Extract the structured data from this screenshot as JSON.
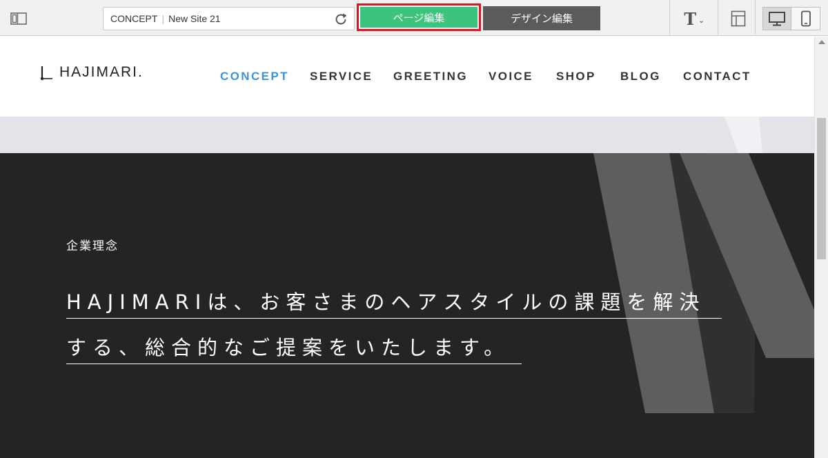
{
  "toolbar": {
    "url_page": "CONCEPT",
    "url_site": "New Site 21",
    "mode_page_label": "ページ編集",
    "mode_design_label": "デザイン編集",
    "font_button": "T",
    "active_device": "desktop",
    "highlight_color": "#e0141e",
    "page_mode_color": "#3cc47c"
  },
  "site": {
    "logo_text": "HAJIMARI.",
    "nav": [
      {
        "label": "CONCEPT",
        "active": true
      },
      {
        "label": "SERVICE",
        "active": false
      },
      {
        "label": "GREETING",
        "active": false
      },
      {
        "label": "VOICE",
        "active": false
      },
      {
        "label": "SHOP",
        "active": false
      },
      {
        "label": "BLOG",
        "active": false
      },
      {
        "label": "CONTACT",
        "active": false
      }
    ],
    "nav_active_color": "#3b94d9",
    "hero": {
      "eyebrow": "企業理念",
      "headline_line1": "HAJIMARIは、お客さまのヘアスタイルの課題を解決",
      "headline_line2": "する、総合的なご提案をいたします。"
    }
  },
  "icons": [
    "sidebar-toggle-icon",
    "reload-icon",
    "font-icon",
    "layout-icon",
    "desktop-icon",
    "mobile-icon"
  ]
}
